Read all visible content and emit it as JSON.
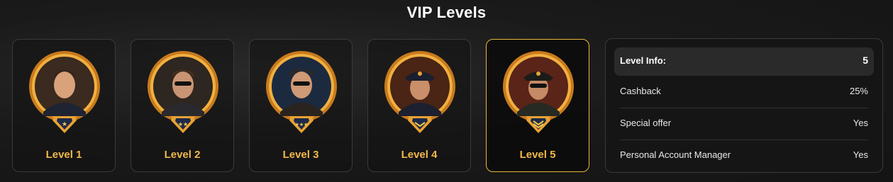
{
  "page": {
    "title": "VIP Levels"
  },
  "levels": [
    {
      "label": "Level 1",
      "stars": 1,
      "active": false
    },
    {
      "label": "Level 2",
      "stars": 2,
      "active": false
    },
    {
      "label": "Level 3",
      "stars": 3,
      "active": false
    },
    {
      "label": "Level 4",
      "stars": 0,
      "active": false
    },
    {
      "label": "Level 5",
      "stars": 0,
      "active": true
    }
  ],
  "info": {
    "header_label": "Level Info:",
    "header_value": "5",
    "rows": [
      {
        "label": "Cashback",
        "value": "25%"
      },
      {
        "label": "Special offer",
        "value": "Yes"
      },
      {
        "label": "Personal Account Manager",
        "value": "Yes"
      }
    ]
  },
  "colors": {
    "accent": "#f2b84b",
    "active_border": "#e8b93a",
    "ring_gold": "#e9a233",
    "badge_navy": "#1e2a4a"
  }
}
